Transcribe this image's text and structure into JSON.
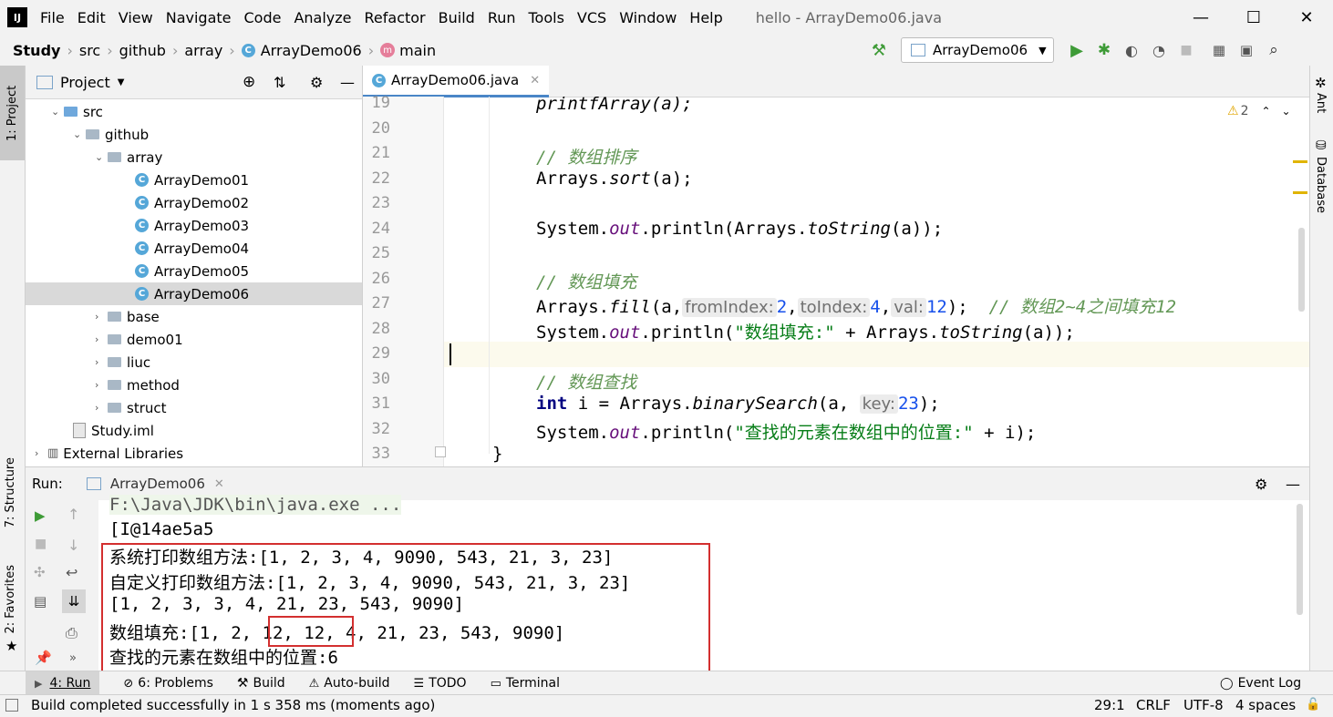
{
  "window": {
    "title": "hello - ArrayDemo06.java",
    "menu": [
      "File",
      "Edit",
      "View",
      "Navigate",
      "Code",
      "Analyze",
      "Refactor",
      "Build",
      "Run",
      "Tools",
      "VCS",
      "Window",
      "Help"
    ],
    "controls": {
      "minimize": "—",
      "maximize": "☐",
      "close": "✕"
    }
  },
  "breadcrumb": [
    "Study",
    "src",
    "github",
    "array",
    "ArrayDemo06",
    "main"
  ],
  "runconfig": {
    "label": "ArrayDemo06"
  },
  "colors": {
    "accent": "#4a86c7",
    "run_green": "#3e9b37",
    "error_red": "#d32f2f",
    "comment": "#629755"
  },
  "left_strip": {
    "project": "1: Project",
    "structure": "7: Structure",
    "favorites": "2: Favorites"
  },
  "right_strip": {
    "ant": "Ant",
    "database": "Database"
  },
  "project_panel": {
    "title": "Project",
    "tree": [
      {
        "label": "src",
        "depth": 1,
        "type": "src-folder",
        "expanded": true
      },
      {
        "label": "github",
        "depth": 2,
        "type": "folder",
        "expanded": true
      },
      {
        "label": "array",
        "depth": 3,
        "type": "folder",
        "expanded": true
      },
      {
        "label": "ArrayDemo01",
        "depth": 4,
        "type": "class"
      },
      {
        "label": "ArrayDemo02",
        "depth": 4,
        "type": "class"
      },
      {
        "label": "ArrayDemo03",
        "depth": 4,
        "type": "class"
      },
      {
        "label": "ArrayDemo04",
        "depth": 4,
        "type": "class"
      },
      {
        "label": "ArrayDemo05",
        "depth": 4,
        "type": "class"
      },
      {
        "label": "ArrayDemo06",
        "depth": 4,
        "type": "class",
        "selected": true
      },
      {
        "label": "base",
        "depth": 3,
        "type": "folder"
      },
      {
        "label": "demo01",
        "depth": 3,
        "type": "folder"
      },
      {
        "label": "liuc",
        "depth": 3,
        "type": "folder"
      },
      {
        "label": "method",
        "depth": 3,
        "type": "folder"
      },
      {
        "label": "struct",
        "depth": 3,
        "type": "folder"
      },
      {
        "label": "Study.iml",
        "depth": 2,
        "type": "file"
      },
      {
        "label": "External Libraries",
        "depth": 0,
        "type": "library"
      }
    ]
  },
  "editor": {
    "tab": "ArrayDemo06.java",
    "warnings": "2",
    "lines": [
      {
        "n": "19"
      },
      {
        "n": "20"
      },
      {
        "n": "21"
      },
      {
        "n": "22"
      },
      {
        "n": "23"
      },
      {
        "n": "24"
      },
      {
        "n": "25"
      },
      {
        "n": "26"
      },
      {
        "n": "27"
      },
      {
        "n": "28"
      },
      {
        "n": "29"
      },
      {
        "n": "30"
      },
      {
        "n": "31"
      },
      {
        "n": "32"
      },
      {
        "n": "33"
      }
    ],
    "code": {
      "l19": "printfArray(a);",
      "l21": "// 数组排序",
      "l22a": "Arrays.",
      "l22b": "sort",
      "l22c": "(a);",
      "l24a": "System.",
      "l24b": "out",
      "l24c": ".println(Arrays.",
      "l24d": "toString",
      "l24e": "(a));",
      "l26": "// 数组填充",
      "l27a": "Arrays.",
      "l27b": "fill",
      "l27c": "(a,",
      "l27h1": "fromIndex:",
      "l27n1": "2",
      "l27d": ",",
      "l27h2": "toIndex:",
      "l27n2": "4",
      "l27e": ",",
      "l27h3": "val:",
      "l27n3": "12",
      "l27f": ");",
      "l27cm": "// 数组2~4之间填充12",
      "l28a": "System.",
      "l28b": "out",
      "l28c": ".println(",
      "l28s": "\"数组填充:\"",
      "l28d": " + Arrays.",
      "l28e": "toString",
      "l28f": "(a));",
      "l30": "// 数组查找",
      "l31k": "int",
      "l31a": " i = Arrays.",
      "l31b": "binarySearch",
      "l31c": "(a,",
      "l31h": "key:",
      "l31n": "23",
      "l31d": ");",
      "l32a": "System.",
      "l32b": "out",
      "l32c": ".println(",
      "l32s": "\"查找的元素在数组中的位置:\"",
      "l32d": " + i);",
      "l33": "}"
    }
  },
  "run_panel": {
    "label": "Run:",
    "tab": "ArrayDemo06",
    "output": [
      "F:\\Java\\JDK\\bin\\java.exe ...",
      "[I@14ae5a5",
      "系统打印数组方法:[1, 2, 3, 4, 9090, 543, 21, 3, 23]",
      "自定义打印数组方法:[1, 2, 3, 4, 9090, 543, 21, 3, 23]",
      "[1, 2, 3, 3, 4, 21, 23, 543, 9090]",
      "数组填充:[1, 2, 12, 12, 4, 21, 23, 543, 9090]",
      "查找的元素在数组中的位置:6"
    ]
  },
  "bottom_tools": [
    "4: Run",
    "6: Problems",
    "Build",
    "Auto-build",
    "TODO",
    "Terminal"
  ],
  "event_log": "Event Log",
  "status": {
    "message": "Build completed successfully in 1 s 358 ms (moments ago)",
    "position": "29:1",
    "line_sep": "CRLF",
    "encoding": "UTF-8",
    "indent": "4 spaces"
  }
}
